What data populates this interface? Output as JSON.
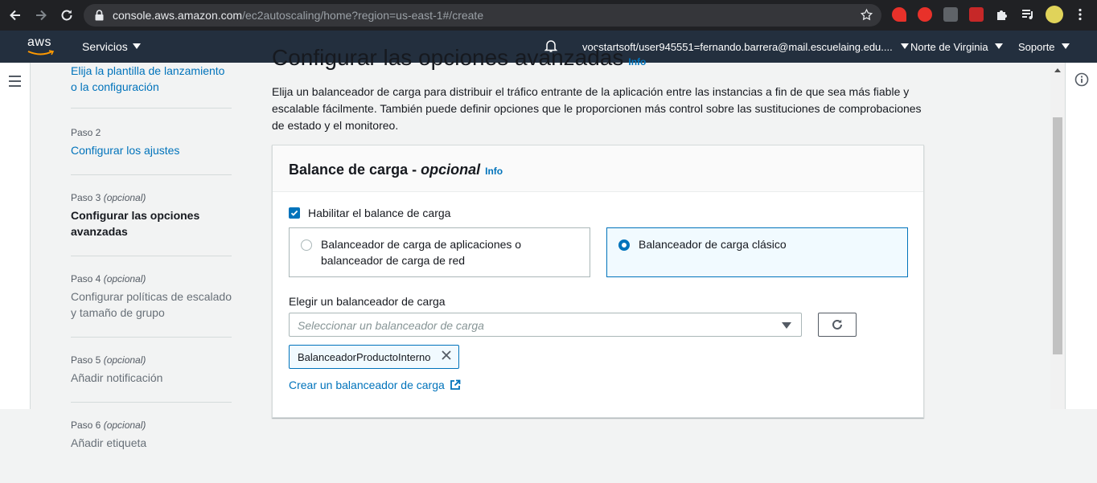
{
  "browser": {
    "url_host": "console.aws.amazon.com",
    "url_path": "/ec2autoscaling/home?region=us-east-1#/create"
  },
  "aws_nav": {
    "logo_text": "aws",
    "services_label": "Servicios",
    "account_label": "vocstartsoft/user945551=fernando.barrera@mail.escuelaing.edu....",
    "region_label": "Norte de Virginia",
    "support_label": "Soporte"
  },
  "steps": [
    {
      "num": "",
      "optional": "",
      "title": "Elija la plantilla de lanzamiento o la configuración",
      "state": "link"
    },
    {
      "num": "Paso 2",
      "optional": "",
      "title": "Configurar los ajustes",
      "state": "link"
    },
    {
      "num": "Paso 3",
      "optional": "(opcional)",
      "title": "Configurar las opciones avanzadas",
      "state": "active"
    },
    {
      "num": "Paso 4",
      "optional": "(opcional)",
      "title": "Configurar políticas de escalado y tamaño de grupo",
      "state": "muted"
    },
    {
      "num": "Paso 5",
      "optional": "(opcional)",
      "title": "Añadir notificación",
      "state": "muted"
    },
    {
      "num": "Paso 6",
      "optional": "(opcional)",
      "title": "Añadir etiqueta",
      "state": "muted"
    }
  ],
  "page": {
    "title": "Configurar las opciones avanzadas",
    "info": "Info",
    "description": "Elija un balanceador de carga para distribuir el tráfico entrante de la aplicación entre las instancias a fin de que sea más fiable y escalable fácilmente. También puede definir opciones que le proporcionen más control sobre las sustituciones de comprobaciones de estado y el monitoreo."
  },
  "card": {
    "title": "Balance de carga -",
    "title_optional": "opcional",
    "info": "Info",
    "enable_label": "Habilitar el balance de carga",
    "enable_checked": true,
    "options": [
      {
        "label": "Balanceador de carga de aplicaciones o balanceador de carga de red",
        "selected": false
      },
      {
        "label": "Balanceador de carga clásico",
        "selected": true
      }
    ],
    "choose_label": "Elegir un balanceador de carga",
    "select_placeholder": "Seleccionar un balanceador de carga",
    "token": "BalanceadorProductoInterno",
    "create_link": "Crear un balanceador de carga"
  },
  "colors": {
    "accent": "#0073bb",
    "nav_bg": "#232f3e",
    "chrome_bg": "#202124"
  }
}
